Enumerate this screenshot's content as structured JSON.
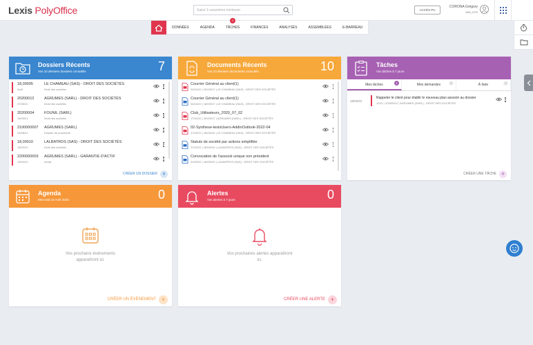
{
  "app": {
    "logo_prefix": "Lexis",
    "logo_brand": "PolyOffice"
  },
  "search": {
    "placeholder": "Saisir 3 caractères minimum"
  },
  "header": {
    "access_button": "ACCÈS PU",
    "user_name": "CORONA Grégory",
    "user_sub": "AVA_LPO"
  },
  "nav": {
    "home": "home",
    "items": [
      "DONNÉES",
      "AGENDA",
      "TÂCHES",
      "FINANCES",
      "ANALYSES",
      "ASSEMBLÉES",
      "E-BARREAU"
    ],
    "tasks_badge": "1"
  },
  "dossiers": {
    "title": "Dossiers Récents",
    "subtitle": "Vos 10 derniers dossiers consultés",
    "count": "7",
    "rows": [
      {
        "code": "18,00005",
        "date": "Actif",
        "title": "LE CHAMEAU (SAS) - DROIT DES SOCIÉTÉS",
        "domain": "Droit des sociétés",
        "color": "#e0364d"
      },
      {
        "code": "20200012",
        "date": "27/05/21",
        "title": "AGRUMES (SARL) - DROIT DES SOCIÉTÉS",
        "domain": "Droit des sociétés",
        "color": "#e0364d"
      },
      {
        "code": "20200004",
        "date": "15/03/21",
        "title": "FOUNIL (SARL)",
        "domain": "Droit des sociétés",
        "color": "#e0364d"
      },
      {
        "code": "2100000007",
        "date": "24/08/21",
        "title": "AGRUMES (SARL)",
        "domain": "Dossier de procédure",
        "color": "#e0364d"
      },
      {
        "code": "18,00010",
        "date": "15/02/21",
        "title": "LALBATROS (SAS) - DROIT DES SOCIÉTÉS",
        "domain": "Droit des sociétés",
        "color": "#e0364d"
      },
      {
        "code": "2200000003",
        "date": "23/04/22",
        "title": "AGRUMES (SARL) - GARANTIE D'ACTIF",
        "domain": "Achat",
        "color": "#e0364d"
      }
    ],
    "footer": "CRÉER UN DOSSIER"
  },
  "documents": {
    "title": "Documents Récents",
    "subtitle": "Vos 10 derniers documents consultés",
    "count": "10",
    "rows": [
      {
        "name": "Courrier Général au client(1)",
        "meta": "04/04/22 | 20/00017 | LE CHAMEAU (SAS) - DROIT DES SOCIÉTÉS",
        "icon": "pdf"
      },
      {
        "name": "Courrier Général au client(1)",
        "meta": "04/04/22 | 18/00017 | LE CHAMEAU (SAS) - DROIT DES SOCIÉTÉS",
        "icon": "word"
      },
      {
        "name": "Club_Utilisateurs_2020_07_02",
        "meta": "17/02/22 | 20/00017 | AGRUMES (SARL) - DROIT DES SOCIÉTÉS",
        "icon": "pdf"
      },
      {
        "name": "02-Synthese-testsUsers-AddinOutlook-2022-04",
        "meta": "17/02/22 | 18/00010 | LE CHAMEAU (SAS) - DROIT DES SOCIÉTÉS",
        "icon": "pdf"
      },
      {
        "name": "Statuts de société par actions simplifiée",
        "meta": "17/02/22 | 18/00010 | LALBATROS (SAS) - DROIT DES SOCIÉTÉS",
        "icon": "word"
      },
      {
        "name": "Convocation de l'associé unique non président",
        "meta": "22/03/22 | 18/00010 | LALBATROS (SAS) - DROIT DES SOCIÉTÉS",
        "icon": "word"
      }
    ]
  },
  "taches": {
    "title": "Tâches",
    "subtitle": "Vos tâches à 7 jours",
    "tabs": [
      {
        "label": "Mes tâches",
        "count": "1"
      },
      {
        "label": "Mes demandes",
        "count": "0"
      },
      {
        "label": "À faire",
        "count": "0"
      }
    ],
    "rows": [
      {
        "date": "18/03/22",
        "title": "Rappeler le client pour établir le nouveau plan associé au dossier",
        "meta": "12/21 | 20200012 | AGRUMES (SARL) - DROIT DES SOCIÉTÉS"
      }
    ],
    "footer": "CRÉER UNE TÂCHE"
  },
  "agenda": {
    "title": "Agenda",
    "subtitle": "Mercredi 16 Avril 2025",
    "count": "0",
    "empty": "Vos prochains événements apparaîtront ici.",
    "footer": "CRÉER UN ÉVÉNEMENT"
  },
  "alertes": {
    "title": "Alertes",
    "subtitle": "Vos alertes à 7 jours",
    "count": "0",
    "empty": "Vos prochaines alertes apparaîtront ici.",
    "footer": "CRÉER UNE ALERTE"
  },
  "colors": {
    "accent": "#e0364d",
    "blue": "#3a86cf",
    "orange": "#f7a83a",
    "purple": "#a761b3",
    "red": "#e84a60"
  }
}
